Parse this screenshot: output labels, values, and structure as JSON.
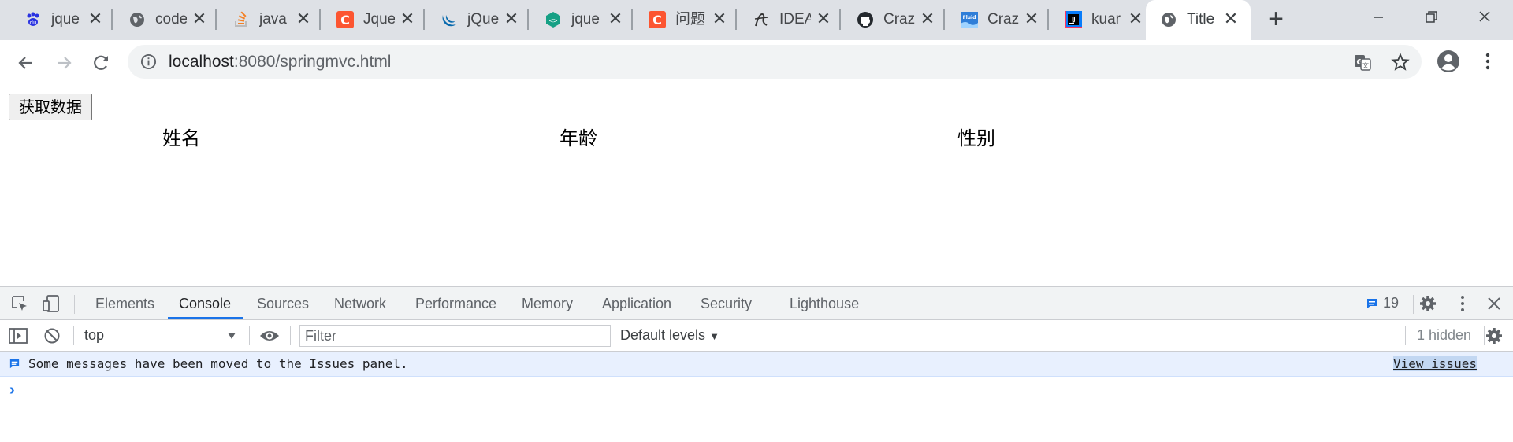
{
  "tabs": [
    {
      "title": "jque",
      "icon": "baidu-paw-icon"
    },
    {
      "title": "code",
      "icon": "globe-icon"
    },
    {
      "title": "java",
      "icon": "stackoverflow-icon"
    },
    {
      "title": "Jque",
      "icon": "csdn-icon"
    },
    {
      "title": "jQue",
      "icon": "jquery-icon"
    },
    {
      "title": "jque",
      "icon": "code-hex-icon"
    },
    {
      "title": "问题",
      "icon": "csdn-icon"
    },
    {
      "title": "IDEA",
      "icon": "idea-pen-icon"
    },
    {
      "title": "Craz",
      "icon": "github-icon"
    },
    {
      "title": "Craz",
      "icon": "fluid-icon"
    },
    {
      "title": "kuar",
      "icon": "intellij-icon"
    },
    {
      "title": "Title",
      "icon": "globe-icon",
      "active": true
    }
  ],
  "toolbar": {
    "url_host": "localhost",
    "url_rest": ":8080/springmvc.html"
  },
  "page": {
    "button_label": "获取数据",
    "columns": [
      "姓名",
      "年龄",
      "性别"
    ]
  },
  "devtools": {
    "tabs": [
      "Elements",
      "Console",
      "Sources",
      "Network",
      "Performance",
      "Memory",
      "Application",
      "Security",
      "Lighthouse"
    ],
    "active_tab": "Console",
    "issues_count": "19",
    "context": "top",
    "filter_placeholder": "Filter",
    "levels": "Default levels",
    "hidden": "1 hidden",
    "message": "Some messages have been moved to the Issues panel.",
    "view_issues": "View issues"
  },
  "colors": {
    "accent": "#1a73e8",
    "tabstrip": "#dee1e6"
  }
}
